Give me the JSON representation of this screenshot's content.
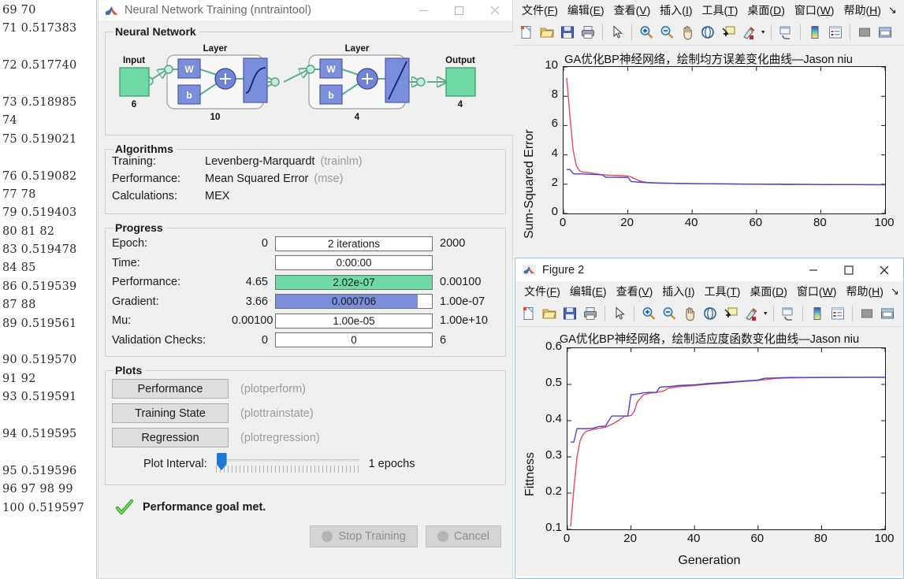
{
  "command_output": {
    "rows": [
      "69  70",
      "71  0.517383",
      "",
      "72  0.517740",
      "",
      "73  0.518985",
      "74",
      "75  0.519021",
      "",
      "76  0.519082",
      "77  78",
      "79  0.519403",
      "80  81  82",
      "83  0.519478",
      "84  85",
      "86  0.519539",
      "87  88",
      "89  0.519561",
      "",
      "90  0.519570",
      "91  92",
      "93  0.519591",
      "",
      "94  0.519595",
      "",
      "95  0.519596",
      "96  97  98  99",
      "100  0.519597"
    ]
  },
  "nntraintool": {
    "title": "Neural Network Training (nntraintool)",
    "logo_icon": "matlab-logo-icon",
    "window_buttons": [
      {
        "name": "minimize-button",
        "icon": "minimize-icon"
      },
      {
        "name": "maximize-button",
        "icon": "maximize-icon"
      },
      {
        "name": "close-button",
        "icon": "close-icon"
      }
    ],
    "neural_network": {
      "legend": "Neural Network",
      "input_label": "Input",
      "input_size": "6",
      "layer1_label": "Layer",
      "layer1_size": "10",
      "layer2_label": "Layer",
      "layer2_size": "4",
      "output_label": "Output",
      "output_size": "4",
      "weight_label": "W",
      "bias_label": "b"
    },
    "algorithms": {
      "legend": "Algorithms",
      "rows": [
        {
          "label": "Training:",
          "value": "Levenberg-Marquardt",
          "fn": "(trainlm)"
        },
        {
          "label": "Performance:",
          "value": "Mean Squared Error",
          "fn": "(mse)"
        },
        {
          "label": "Calculations:",
          "value": "MEX",
          "fn": ""
        }
      ]
    },
    "progress": {
      "legend": "Progress",
      "rows": [
        {
          "label": "Epoch:",
          "min": "0",
          "value": "2 iterations",
          "max": "2000",
          "fill_pct": 0,
          "fill_color": "#ffffff"
        },
        {
          "label": "Time:",
          "min": "",
          "value": "0:00:00",
          "max": "",
          "fill_pct": 0,
          "fill_color": "#ffffff"
        },
        {
          "label": "Performance:",
          "min": "4.65",
          "value": "2.02e-07",
          "max": "0.00100",
          "fill_pct": 100,
          "fill_color": "#6edaa5"
        },
        {
          "label": "Gradient:",
          "min": "3.66",
          "value": "0.000706",
          "max": "1.00e-07",
          "fill_pct": 91,
          "fill_color": "#7b8edb"
        },
        {
          "label": "Mu:",
          "min": "0.00100",
          "value": "1.00e-05",
          "max": "1.00e+10",
          "fill_pct": 0,
          "fill_color": "#ffffff"
        },
        {
          "label": "Validation Checks:",
          "min": "0",
          "value": "0",
          "max": "6",
          "fill_pct": 0,
          "fill_color": "#ffffff"
        }
      ]
    },
    "plots": {
      "legend": "Plots",
      "buttons": [
        {
          "label": "Performance",
          "fn": "(plotperform)"
        },
        {
          "label": "Training State",
          "fn": "(plottrainstate)"
        },
        {
          "label": "Regression",
          "fn": "(plotregression)"
        }
      ],
      "interval_label": "Plot Interval:",
      "interval_value": "1 epochs"
    },
    "status": {
      "icon": "green-check-icon",
      "text": "Performance goal met."
    },
    "actions": [
      {
        "label": "Stop Training",
        "icon": "stop-icon",
        "disabled": true
      },
      {
        "label": "Cancel",
        "icon": "cancel-icon",
        "disabled": true
      }
    ]
  },
  "figure_menu": {
    "items": [
      {
        "pre": "文件(",
        "key": "F",
        "post": ")"
      },
      {
        "pre": "编辑(",
        "key": "E",
        "post": ")"
      },
      {
        "pre": "查看(",
        "key": "V",
        "post": ")"
      },
      {
        "pre": "插入(",
        "key": "I",
        "post": ")"
      },
      {
        "pre": "工具(",
        "key": "T",
        "post": ")"
      },
      {
        "pre": "桌面(",
        "key": "D",
        "post": ")"
      },
      {
        "pre": "窗口(",
        "key": "W",
        "post": ")"
      },
      {
        "pre": "帮助(",
        "key": "H",
        "post": ")"
      }
    ],
    "overflow": "↘"
  },
  "figure_toolbar": {
    "buttons": [
      "new-figure-icon",
      "open-file-icon",
      "save-figure-icon",
      "print-figure-icon",
      "pointer-icon",
      "zoom-in-icon",
      "zoom-out-icon",
      "pan-icon",
      "rotate-3d-icon",
      "data-cursor-icon",
      "brush-icon",
      "brush-dropdown-icon",
      "link-plot-icon",
      "colorbar-icon",
      "legend-icon",
      "hide-plot-tools-icon",
      "show-plot-tools-icon"
    ]
  },
  "figure1": {
    "window_name": "figure-1-window"
  },
  "figure2": {
    "title": "Figure 2",
    "logo_icon": "matlab-logo-icon",
    "window_buttons": [
      {
        "name": "minimize-button",
        "icon": "minimize-icon"
      },
      {
        "name": "maximize-button",
        "icon": "maximize-icon"
      },
      {
        "name": "close-button",
        "icon": "close-icon"
      }
    ]
  },
  "chart_data": [
    {
      "type": "line",
      "id": "mse-curve",
      "title": "GA优化BP神经网络，绘制均方误差变化曲线—Jason niu",
      "xlabel": "",
      "ylabel": "Sum-Squared Error",
      "xlim": [
        0,
        100
      ],
      "ylim": [
        0,
        10
      ],
      "xticks": [
        0,
        20,
        40,
        60,
        80,
        100
      ],
      "yticks": [
        0,
        2,
        4,
        6,
        8,
        10
      ],
      "grid": false,
      "legend": "none",
      "series": [
        {
          "name": "series-red",
          "color": "#e8455e",
          "x": [
            1,
            2,
            3,
            4,
            5,
            6,
            8,
            10,
            12,
            14,
            16,
            18,
            20,
            21,
            22,
            24,
            26,
            30,
            35,
            40,
            50,
            60,
            70,
            80,
            90,
            100
          ],
          "values": [
            9.25,
            6.6,
            4.3,
            3.25,
            2.9,
            2.83,
            2.78,
            2.72,
            2.65,
            2.62,
            2.6,
            2.58,
            2.55,
            2.5,
            2.38,
            2.2,
            2.12,
            2.08,
            2.05,
            2.04,
            2.02,
            2.0,
            1.99,
            1.98,
            1.97,
            1.96
          ]
        },
        {
          "name": "series-blue",
          "color": "#4646d2",
          "x": [
            1,
            2,
            3,
            4,
            5,
            6,
            8,
            10,
            12,
            13,
            14,
            16,
            18,
            20,
            21,
            22,
            24,
            26,
            30,
            40,
            50,
            60,
            70,
            80,
            90,
            100
          ],
          "values": [
            3.0,
            3.0,
            2.72,
            2.7,
            2.7,
            2.7,
            2.68,
            2.66,
            2.64,
            2.48,
            2.47,
            2.47,
            2.46,
            2.46,
            2.18,
            2.16,
            2.13,
            2.1,
            2.07,
            2.04,
            2.02,
            2.0,
            1.99,
            1.98,
            1.97,
            1.96
          ]
        }
      ]
    },
    {
      "type": "line",
      "id": "fitness-curve",
      "title": "GA优化BP神经网络，绘制适应度函数变化曲线—Jason niu",
      "xlabel": "Generation",
      "ylabel": "Fittness",
      "xlim": [
        0,
        100
      ],
      "ylim": [
        0.1,
        0.6
      ],
      "xticks": [
        0,
        20,
        40,
        60,
        80,
        100
      ],
      "yticks": [
        0.1,
        0.2,
        0.3,
        0.4,
        0.5,
        0.6
      ],
      "grid": false,
      "legend": "none",
      "series": [
        {
          "name": "series-red",
          "color": "#e8455e",
          "x": [
            1,
            2,
            3,
            4,
            5,
            6,
            8,
            10,
            12,
            14,
            16,
            18,
            20,
            21,
            22,
            24,
            26,
            28,
            30,
            32,
            35,
            40,
            45,
            50,
            55,
            60,
            63,
            66,
            70,
            80,
            90,
            100
          ],
          "values": [
            0.108,
            0.21,
            0.3,
            0.345,
            0.363,
            0.371,
            0.376,
            0.379,
            0.382,
            0.39,
            0.4,
            0.412,
            0.414,
            0.425,
            0.452,
            0.472,
            0.476,
            0.478,
            0.481,
            0.49,
            0.494,
            0.497,
            0.501,
            0.504,
            0.508,
            0.511,
            0.514,
            0.517,
            0.518,
            0.519,
            0.5195,
            0.5196
          ]
        },
        {
          "name": "series-blue",
          "color": "#4646d2",
          "x": [
            1,
            2,
            3,
            4,
            6,
            8,
            10,
            12,
            13,
            14,
            16,
            18,
            19,
            20,
            21,
            24,
            26,
            28,
            29,
            30,
            32,
            35,
            40,
            45,
            50,
            55,
            60,
            62,
            66,
            70,
            80,
            90,
            100
          ],
          "values": [
            0.341,
            0.341,
            0.378,
            0.378,
            0.378,
            0.379,
            0.384,
            0.385,
            0.4,
            0.413,
            0.413,
            0.413,
            0.413,
            0.472,
            0.472,
            0.477,
            0.478,
            0.478,
            0.492,
            0.493,
            0.494,
            0.497,
            0.499,
            0.503,
            0.506,
            0.509,
            0.512,
            0.517,
            0.518,
            0.519,
            0.5195,
            0.5197,
            0.5198
          ]
        }
      ]
    }
  ]
}
